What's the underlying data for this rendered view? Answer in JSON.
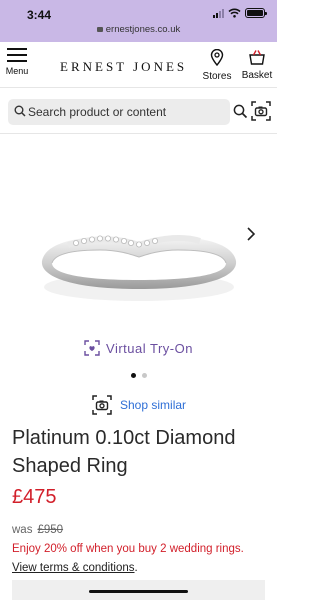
{
  "status_bar": {
    "time": "3:44",
    "url": "ernestjones.co.uk",
    "background": "#c9b8e6"
  },
  "header": {
    "menu_label": "Menu",
    "logo_text": "ERNEST JONES",
    "stores_label": "Stores",
    "basket_label": "Basket"
  },
  "search": {
    "placeholder": "Search product or content",
    "icon": "search-icon",
    "camera_icon": "camera-search-icon"
  },
  "carousel": {
    "next_icon": "chevron-right-icon",
    "slide_count": 2,
    "active_slide": 1
  },
  "try_on": {
    "label": "Virtual Try-On",
    "icon": "virtual-try-on-icon",
    "color": "#6b4fa0"
  },
  "shop_similar": {
    "label": "Shop similar",
    "icon": "camera-search-icon",
    "color": "#2f6fd6"
  },
  "product": {
    "title": "Platinum 0.10ct Diamond Shaped Ring",
    "price": "£475",
    "was_label": "was",
    "was_price": "£950",
    "promo_text": "Enjoy 20% off when you buy 2 wedding rings.",
    "terms_link": "View terms & conditions",
    "terms_suffix": ".",
    "price_color": "#d21f2a"
  }
}
